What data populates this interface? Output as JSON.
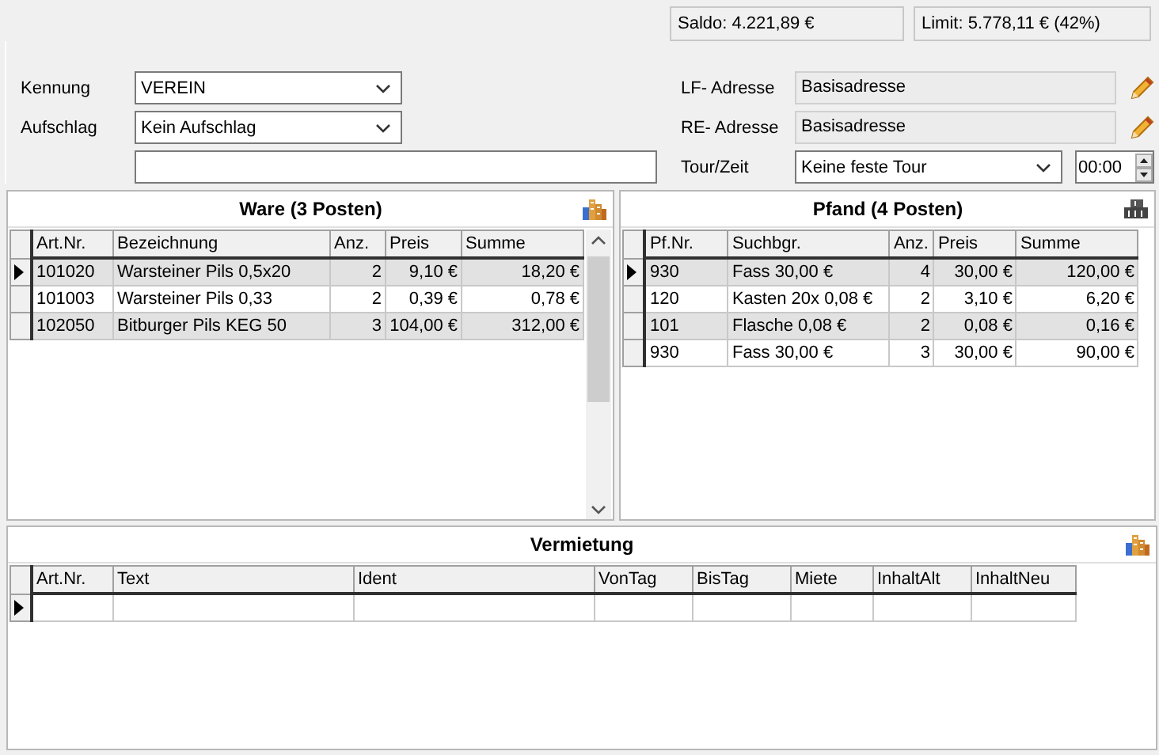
{
  "status": {
    "saldo": "Saldo: 4.221,89 €",
    "limit": "Limit: 5.778,11 € (42%)"
  },
  "form": {
    "left": [
      {
        "kind": "combo",
        "label": "Kennung",
        "value": "VEREIN"
      },
      {
        "kind": "combo",
        "label": "Aufschlag",
        "value": "Kein Aufschlag"
      },
      {
        "kind": "text"
      }
    ],
    "right": [
      {
        "kind": "address",
        "label": "LF- Adresse",
        "value": "Basisadresse"
      },
      {
        "kind": "address",
        "label": "RE- Adresse",
        "value": "Basisadresse"
      },
      {
        "kind": "tour",
        "label": "Tour/Zeit",
        "value": "Keine feste Tour",
        "time": "00:00"
      }
    ]
  },
  "ware": {
    "title": "Ware (3 Posten)",
    "scrollbar": true,
    "columns": [
      "Art.Nr.",
      "Bezeichnung",
      "Anz.",
      "Preis",
      "Summe"
    ],
    "rows": [
      {
        "selected": true,
        "cells": [
          "101020",
          "Warsteiner Pils 0,5x20",
          "2",
          "9,10 €",
          "18,20 €"
        ]
      },
      {
        "selected": false,
        "cells": [
          "101003",
          "Warsteiner Pils 0,33",
          "2",
          "0,39 €",
          "0,78 €"
        ]
      },
      {
        "selected": false,
        "cells": [
          "102050",
          "Bitburger Pils KEG 50",
          "3",
          "104,00 €",
          "312,00 €"
        ]
      }
    ]
  },
  "pfand": {
    "title": "Pfand (4 Posten)",
    "columns": [
      "Pf.Nr.",
      "Suchbgr.",
      "Anz.",
      "Preis",
      "Summe"
    ],
    "rows": [
      {
        "selected": true,
        "cells": [
          "930",
          "Fass 30,00 €",
          "4",
          "30,00 €",
          "120,00 €"
        ]
      },
      {
        "selected": false,
        "cells": [
          "120",
          "Kasten 20x 0,08 €",
          "2",
          "3,10 €",
          "6,20 €"
        ]
      },
      {
        "selected": false,
        "cells": [
          "101",
          "Flasche 0,08 €",
          "2",
          "0,08 €",
          "0,16 €"
        ]
      },
      {
        "selected": false,
        "cells": [
          "930",
          "Fass 30,00 €",
          "3",
          "30,00 €",
          "90,00 €"
        ]
      }
    ]
  },
  "vermietung": {
    "title": "Vermietung",
    "columns": [
      "Art.Nr.",
      "Text",
      "Ident",
      "VonTag",
      "BisTag",
      "Miete",
      "InhaltAlt",
      "InhaltNeu"
    ],
    "rows": [
      {
        "selected": true
      }
    ]
  }
}
